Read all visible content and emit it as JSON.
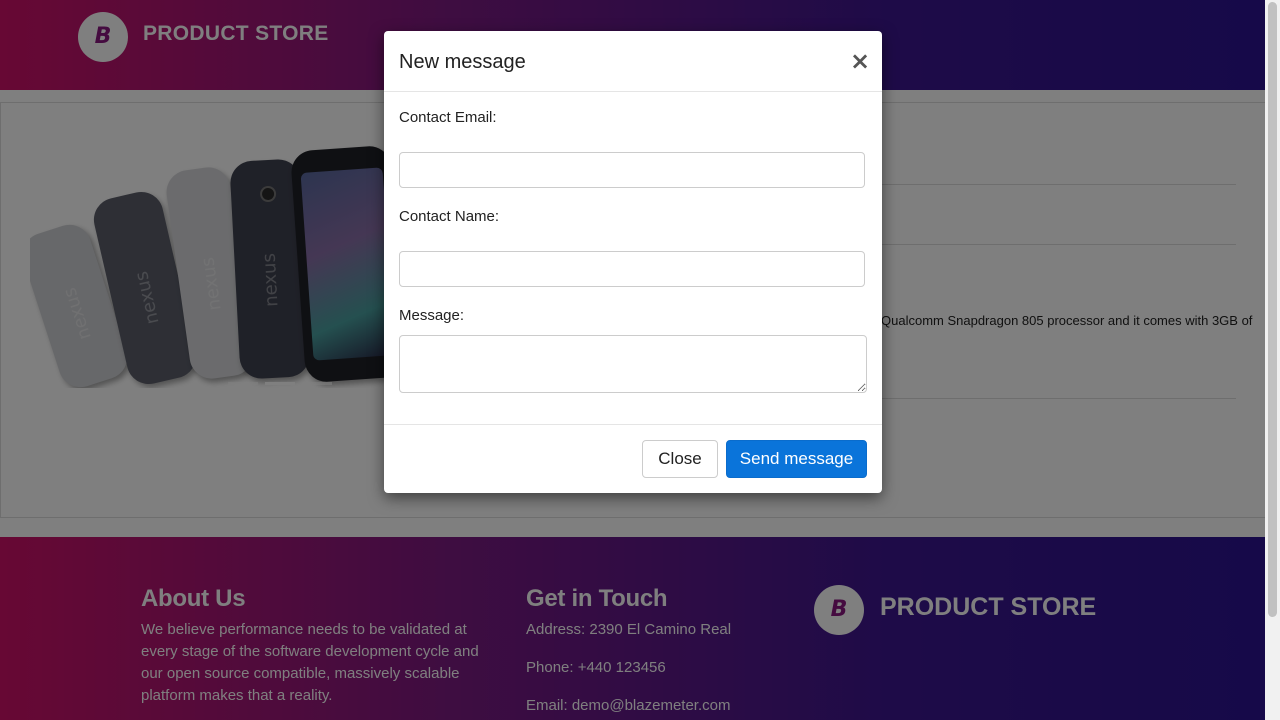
{
  "navbar": {
    "logo_letter": "B",
    "brand": "PRODUCT STORE"
  },
  "product": {
    "carousel_phone_label": "nexus",
    "description_fragment": "Qualcomm Snapdragon 805 processor and it comes with 3GB of"
  },
  "modal": {
    "title": "New message",
    "close_x": "×",
    "email_label": "Contact Email:",
    "email_value": "",
    "name_label": "Contact Name:",
    "name_value": "",
    "message_label": "Message:",
    "message_value": "",
    "close_button": "Close",
    "send_button": "Send message"
  },
  "footer": {
    "about_title": "About Us",
    "about_text": "We believe performance needs to be validated at every stage of the software development cycle and our open source compatible, massively scalable platform makes that a reality.",
    "contact_title": "Get in Touch",
    "address": "Address: 2390 El Camino Real",
    "phone": "Phone: +440 123456",
    "email": "Email: demo@blazemeter.com",
    "logo_letter": "B",
    "brand": "PRODUCT STORE"
  },
  "colors": {
    "gradient_start": "#cf1168",
    "gradient_end": "#2c1392",
    "primary_button": "#0a74da"
  }
}
